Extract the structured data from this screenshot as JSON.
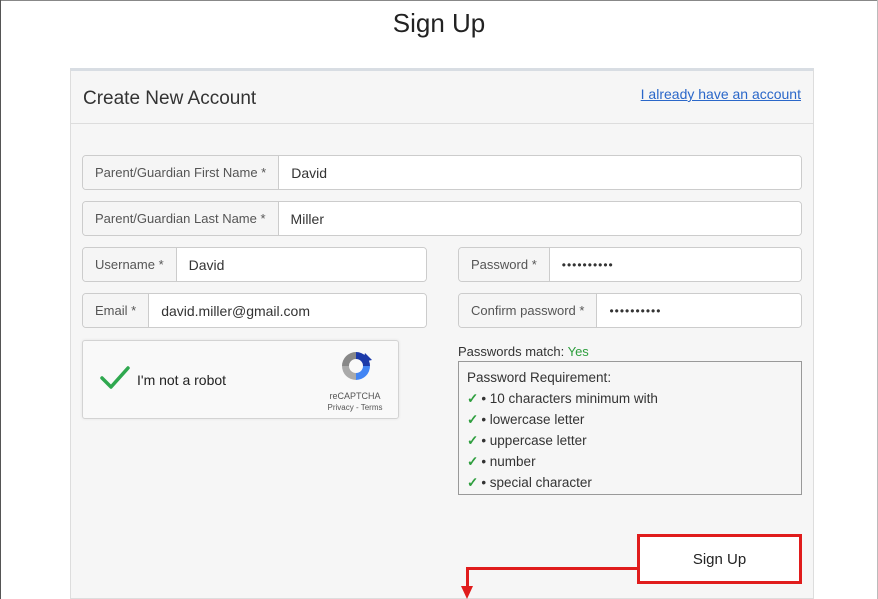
{
  "page": {
    "title": "Sign Up"
  },
  "panel": {
    "title": "Create New Account",
    "login_link": "I already have an account"
  },
  "form": {
    "first_name": {
      "label": "Parent/Guardian First Name *",
      "value": "David"
    },
    "last_name": {
      "label": "Parent/Guardian Last Name *",
      "value": "Miller"
    },
    "username": {
      "label": "Username *",
      "value": "David"
    },
    "email": {
      "label": "Email *",
      "value": "david.miller@gmail.com"
    },
    "password": {
      "label": "Password *",
      "value": "••••••••••"
    },
    "confirm_password": {
      "label": "Confirm password *",
      "value": "••••••••••"
    }
  },
  "captcha": {
    "label": "I'm not a robot",
    "brand": "reCAPTCHA",
    "privacy": "Privacy",
    "separator": " - ",
    "terms": "Terms"
  },
  "password_check": {
    "match_label": "Passwords match:",
    "match_value": "Yes",
    "requirements_title": "Password Requirement:",
    "requirements": [
      "• 10 characters minimum with",
      "• lowercase letter",
      "• uppercase letter",
      "• number",
      "• special character"
    ],
    "tick": "✓",
    "tick_color": "#2e9e3e"
  },
  "actions": {
    "signup_label": "Sign Up"
  },
  "colors": {
    "highlight": "#e01c1c",
    "link": "#2a67c9"
  }
}
